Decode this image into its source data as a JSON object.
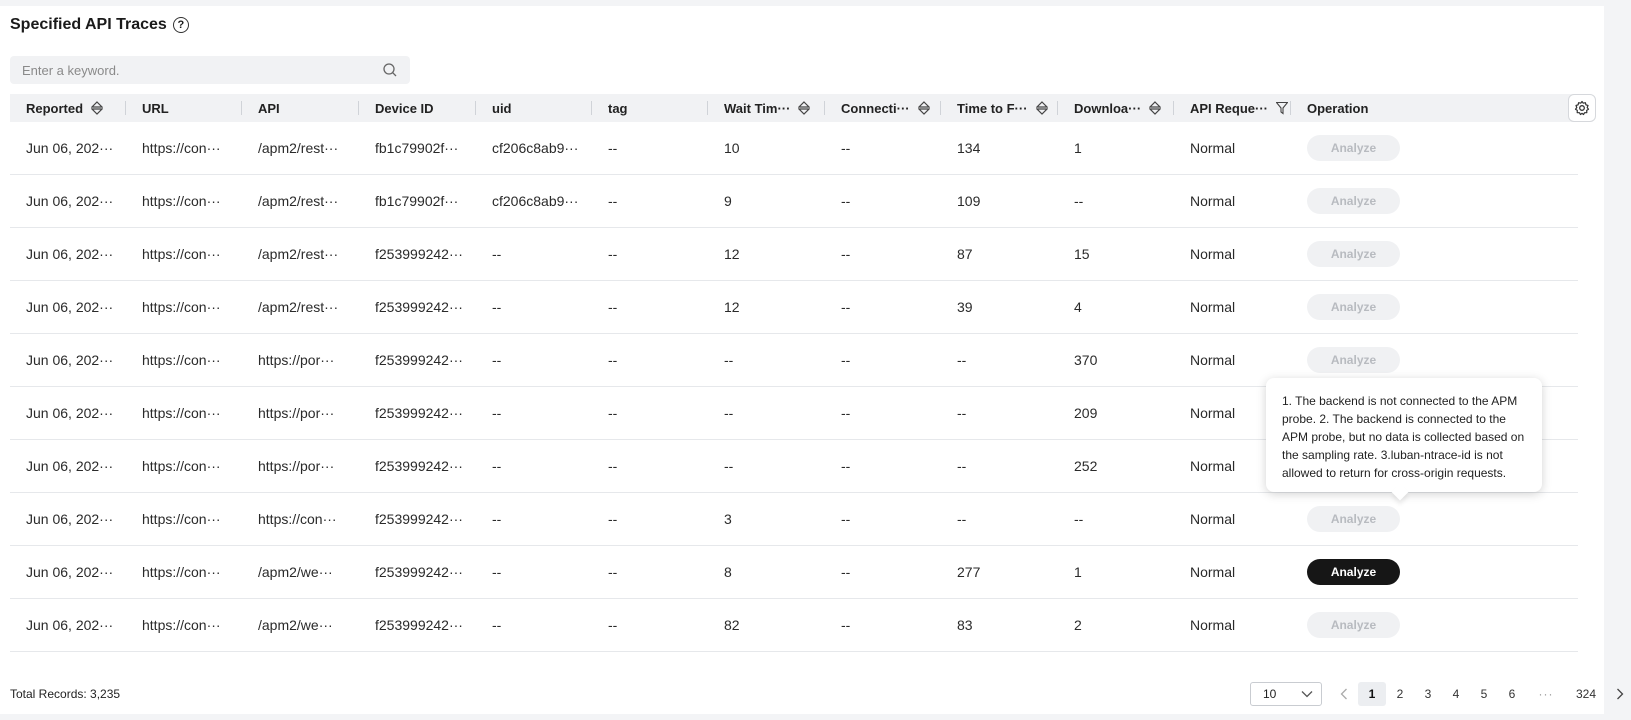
{
  "page": {
    "title": "Specified API Traces"
  },
  "search": {
    "placeholder": "Enter a keyword."
  },
  "columns": [
    {
      "label": "Reported",
      "icon": "sort-icon"
    },
    {
      "label": "URL",
      "icon": ""
    },
    {
      "label": "API",
      "icon": ""
    },
    {
      "label": "Device ID",
      "icon": ""
    },
    {
      "label": "uid",
      "icon": ""
    },
    {
      "label": "tag",
      "icon": ""
    },
    {
      "label": "Wait Tim···",
      "icon": "sort-icon"
    },
    {
      "label": "Connecti···",
      "icon": "sort-icon"
    },
    {
      "label": "Time to F···",
      "icon": "sort-icon"
    },
    {
      "label": "Downloa···",
      "icon": "sort-icon"
    },
    {
      "label": "API Reque···",
      "icon": "filter-icon"
    },
    {
      "label": "Operation",
      "icon": ""
    }
  ],
  "rows": [
    {
      "reported": "Jun 06, 202···",
      "url": "https://con···",
      "api": "/apm2/rest···",
      "device": "fb1c79902f···",
      "uid": "cf206c8ab9···",
      "tag": "--",
      "wait": "10",
      "conn": "--",
      "ttf": "134",
      "download": "1",
      "status": "Normal",
      "action": "Analyze",
      "active": false
    },
    {
      "reported": "Jun 06, 202···",
      "url": "https://con···",
      "api": "/apm2/rest···",
      "device": "fb1c79902f···",
      "uid": "cf206c8ab9···",
      "tag": "--",
      "wait": "9",
      "conn": "--",
      "ttf": "109",
      "download": "--",
      "status": "Normal",
      "action": "Analyze",
      "active": false
    },
    {
      "reported": "Jun 06, 202···",
      "url": "https://con···",
      "api": "/apm2/rest···",
      "device": "f253999242···",
      "uid": "--",
      "tag": "--",
      "wait": "12",
      "conn": "--",
      "ttf": "87",
      "download": "15",
      "status": "Normal",
      "action": "Analyze",
      "active": false
    },
    {
      "reported": "Jun 06, 202···",
      "url": "https://con···",
      "api": "/apm2/rest···",
      "device": "f253999242···",
      "uid": "--",
      "tag": "--",
      "wait": "12",
      "conn": "--",
      "ttf": "39",
      "download": "4",
      "status": "Normal",
      "action": "Analyze",
      "active": false
    },
    {
      "reported": "Jun 06, 202···",
      "url": "https://con···",
      "api": "https://por···",
      "device": "f253999242···",
      "uid": "--",
      "tag": "--",
      "wait": "--",
      "conn": "--",
      "ttf": "--",
      "download": "370",
      "status": "Normal",
      "action": "Analyze",
      "active": false
    },
    {
      "reported": "Jun 06, 202···",
      "url": "https://con···",
      "api": "https://por···",
      "device": "f253999242···",
      "uid": "--",
      "tag": "--",
      "wait": "--",
      "conn": "--",
      "ttf": "--",
      "download": "209",
      "status": "Normal",
      "action": "",
      "active": false
    },
    {
      "reported": "Jun 06, 202···",
      "url": "https://con···",
      "api": "https://por···",
      "device": "f253999242···",
      "uid": "--",
      "tag": "--",
      "wait": "--",
      "conn": "--",
      "ttf": "--",
      "download": "252",
      "status": "Normal",
      "action": "",
      "active": false
    },
    {
      "reported": "Jun 06, 202···",
      "url": "https://con···",
      "api": "https://con···",
      "device": "f253999242···",
      "uid": "--",
      "tag": "--",
      "wait": "3",
      "conn": "--",
      "ttf": "--",
      "download": "--",
      "status": "Normal",
      "action": "Analyze",
      "active": false
    },
    {
      "reported": "Jun 06, 202···",
      "url": "https://con···",
      "api": "/apm2/we···",
      "device": "f253999242···",
      "uid": "--",
      "tag": "--",
      "wait": "8",
      "conn": "--",
      "ttf": "277",
      "download": "1",
      "status": "Normal",
      "action": "Analyze",
      "active": true
    },
    {
      "reported": "Jun 06, 202···",
      "url": "https://con···",
      "api": "/apm2/we···",
      "device": "f253999242···",
      "uid": "--",
      "tag": "--",
      "wait": "82",
      "conn": "--",
      "ttf": "83",
      "download": "2",
      "status": "Normal",
      "action": "Analyze",
      "active": false
    }
  ],
  "tooltip": {
    "text": "1. The backend is not connected to the APM probe. 2. The backend is connected to the APM probe, but no data is collected based on the sampling rate. 3.luban-ntrace-id is not allowed to return for cross-origin requests."
  },
  "footer": {
    "total": "Total Records: 3,235",
    "page_size": "10",
    "pages": [
      "1",
      "2",
      "3",
      "4",
      "5",
      "6",
      "···",
      "324"
    ],
    "current_page": "1"
  },
  "colors": {
    "active_button": "#161616",
    "disabled_button": "#f0f1f3",
    "header_bg": "#f1f2f4"
  }
}
